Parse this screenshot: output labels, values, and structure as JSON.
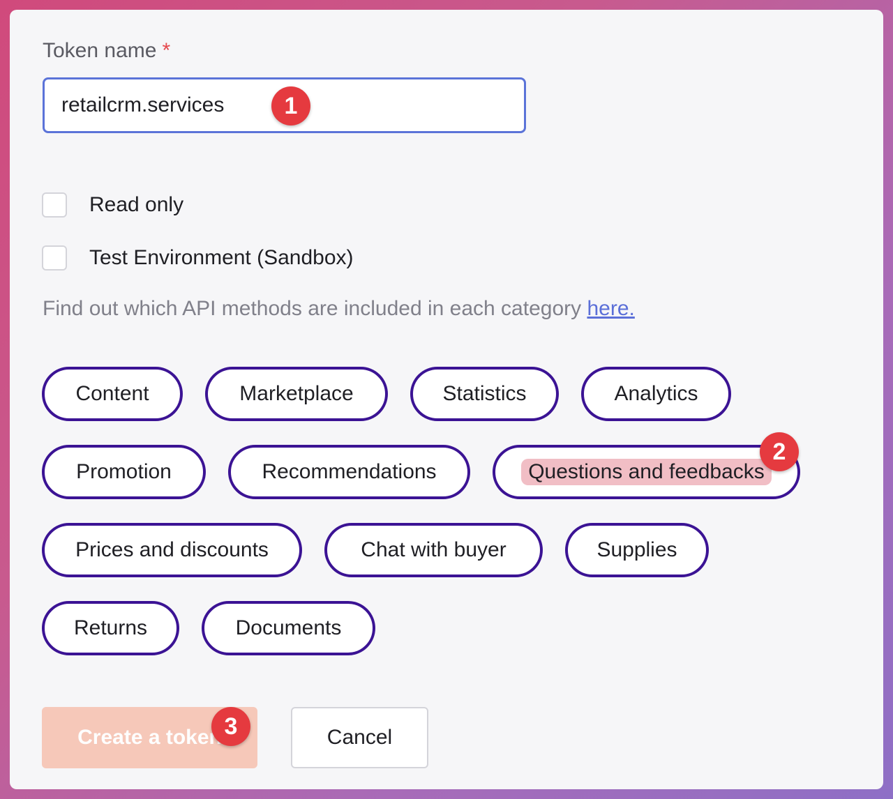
{
  "form": {
    "token_label": "Token name",
    "required_mark": "*",
    "token_value": "retailcrm.services",
    "read_only_label": "Read only",
    "sandbox_label": "Test Environment (Sandbox)",
    "info_text": "Find out which API methods are included in each category ",
    "info_link": "here."
  },
  "categories": [
    "Content",
    "Marketplace",
    "Statistics",
    "Analytics",
    "Promotion",
    "Recommendations",
    "Questions and feedbacks",
    "Prices and discounts",
    "Chat with buyer",
    "Supplies",
    "Returns",
    "Documents"
  ],
  "buttons": {
    "create": "Create a token",
    "cancel": "Cancel"
  },
  "step_badges": [
    "1",
    "2",
    "3"
  ],
  "colors": {
    "chip_border": "#3b1394",
    "highlight": "#f1bec5",
    "badge": "#e53a3f",
    "input_border": "#5b73d8",
    "create_button": "#f6c6b6"
  }
}
